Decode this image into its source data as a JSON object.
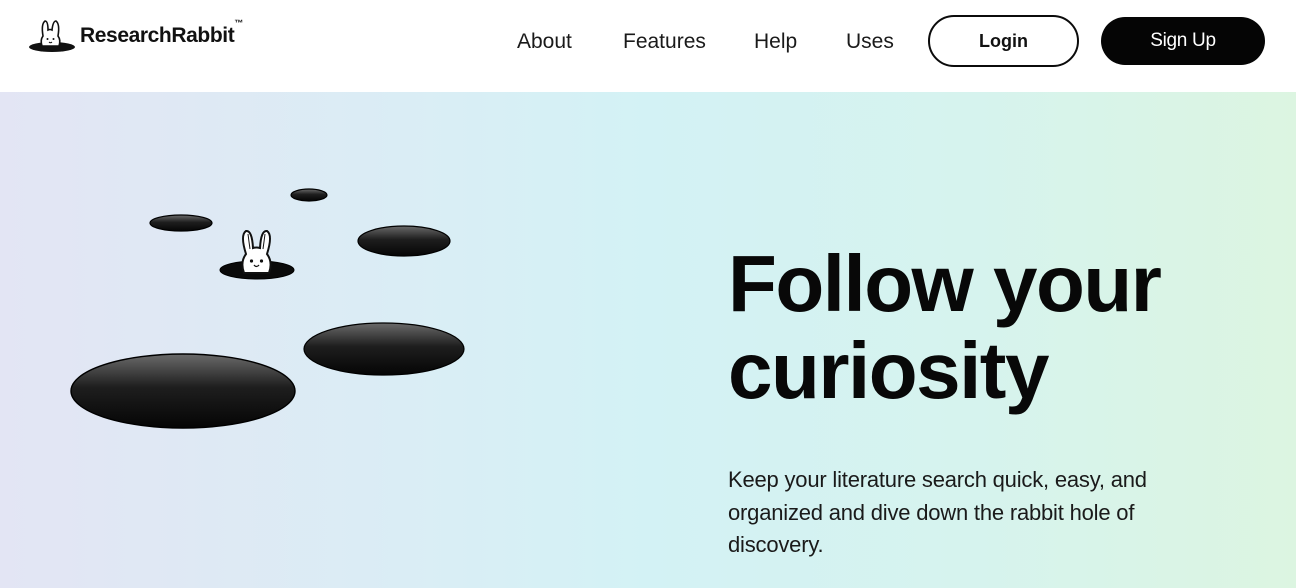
{
  "brand": {
    "name": "ResearchRabbit",
    "trademark": "™"
  },
  "nav": {
    "items": [
      "About",
      "Features",
      "Help",
      "Uses"
    ],
    "login_label": "Login",
    "signup_label": "Sign Up"
  },
  "hero": {
    "title": "Follow your curiosity",
    "subtitle": "Keep your literature search quick, easy, and organized and dive down the rabbit hole of discovery."
  },
  "colors": {
    "accent": "#050505",
    "hero_gradient_left": "#e3e5f4",
    "hero_gradient_mid": "#d3f2f5",
    "hero_gradient_right": "#dcf5e1"
  },
  "icons": [
    "rabbit-logo-icon",
    "rabbit-hole-illustration"
  ]
}
